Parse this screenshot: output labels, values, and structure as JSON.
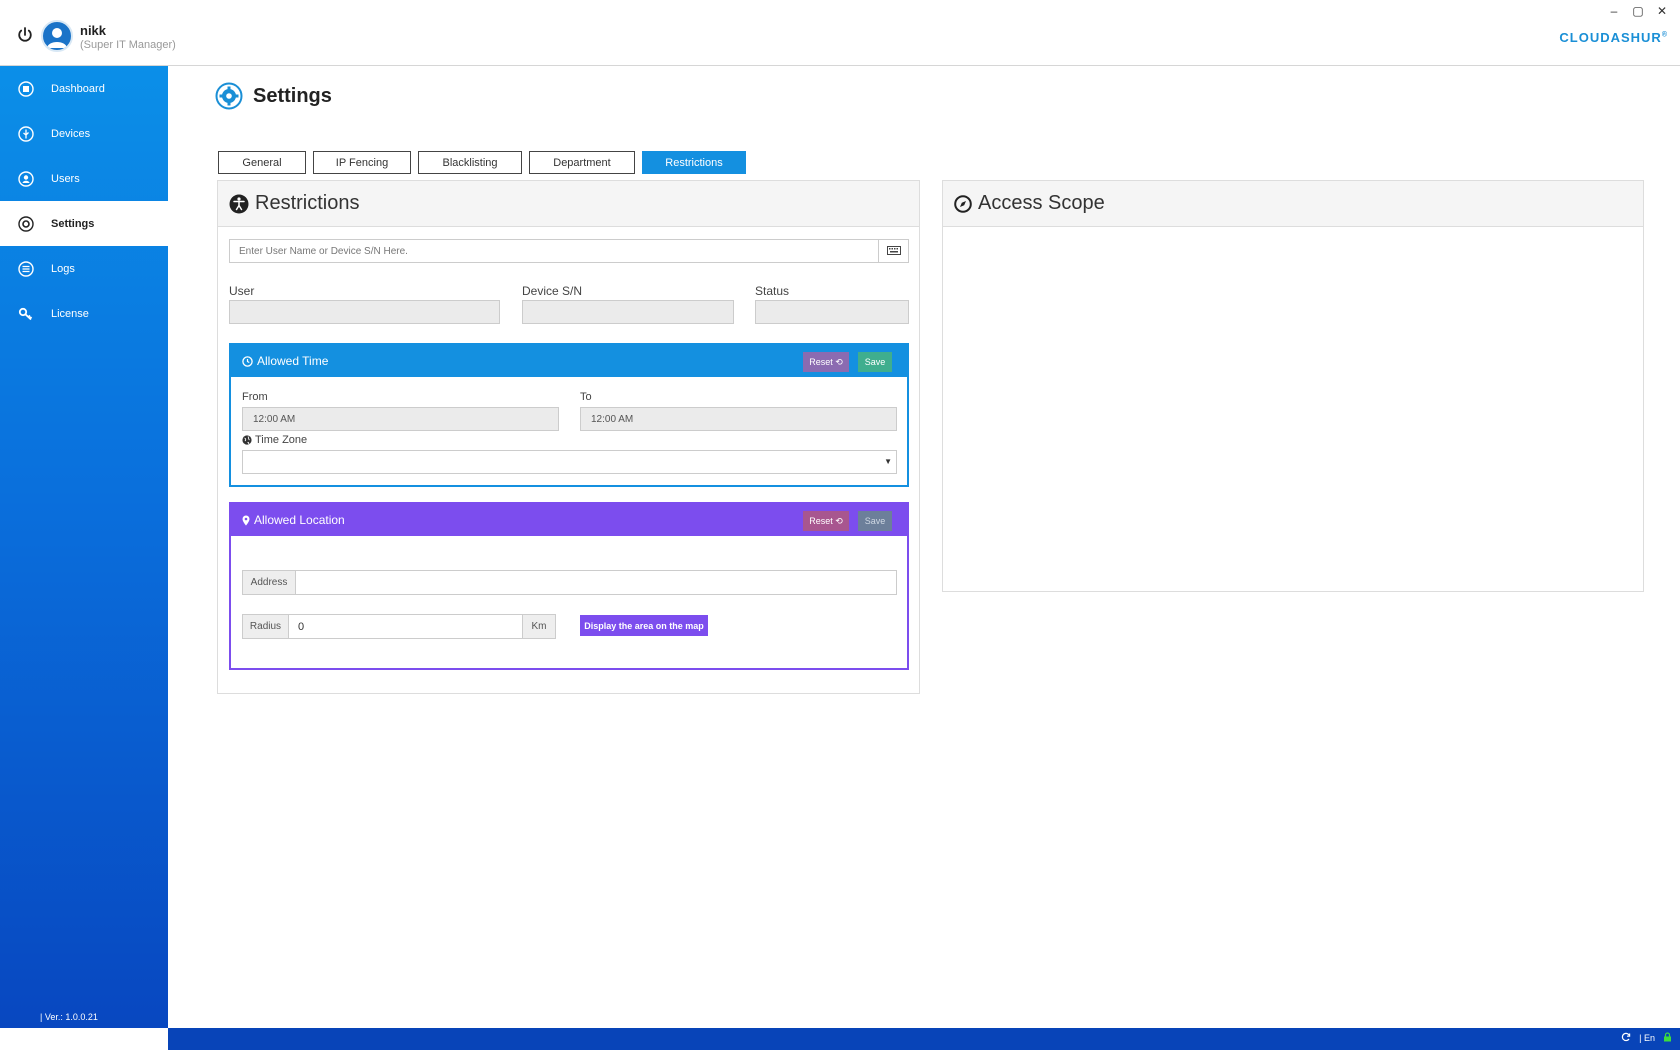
{
  "window": {
    "minimize": "–",
    "maximize": "▢",
    "close": "✕"
  },
  "user": {
    "name": "nikk",
    "role": "(Super IT Manager)"
  },
  "brand": {
    "name": "CLOUDASHUR",
    "mark": "®"
  },
  "sidebar": {
    "items": [
      {
        "label": "Dashboard",
        "icon": "dashboard-icon"
      },
      {
        "label": "Devices",
        "icon": "usb-icon"
      },
      {
        "label": "Users",
        "icon": "user-icon"
      },
      {
        "label": "Settings",
        "icon": "gear-icon",
        "active": true
      },
      {
        "label": "Logs",
        "icon": "list-icon"
      },
      {
        "label": "License",
        "icon": "key-icon"
      }
    ],
    "version": "| Ver.: 1.0.0.21"
  },
  "statusbar": {
    "language": "| En"
  },
  "page": {
    "title": "Settings"
  },
  "tabs": [
    {
      "label": "General"
    },
    {
      "label": "IP Fencing"
    },
    {
      "label": "Blacklisting"
    },
    {
      "label": "Department"
    },
    {
      "label": "Restrictions",
      "active": true
    }
  ],
  "restrictions": {
    "title": "Restrictions",
    "search_placeholder": "Enter User Name or Device S/N Here.",
    "user_label": "User",
    "device_label": "Device S/N",
    "status_label": "Status"
  },
  "allowed_time": {
    "title": "Allowed Time",
    "reset_label": "Reset",
    "save_label": "Save",
    "from_label": "From",
    "from_value": "12:00 AM",
    "to_label": "To",
    "to_value": "12:00 AM",
    "timezone_label": "Time Zone",
    "timezone_value": ""
  },
  "allowed_location": {
    "title": "Allowed Location",
    "reset_label": "Reset",
    "save_label": "Save",
    "address_label": "Address",
    "address_value": "",
    "radius_label": "Radius",
    "radius_value": "0",
    "radius_unit": "Km",
    "map_button": "Display the area on the map"
  },
  "access_scope": {
    "title": "Access Scope"
  },
  "colors": {
    "accent_blue": "#1490e0",
    "sidebar_top": "#0b8fe8",
    "sidebar_bottom": "#0847c0",
    "allowed_location_purple": "#7c4dee",
    "reset_button": "#8b6bb1",
    "save_button": "#3fae8e"
  }
}
